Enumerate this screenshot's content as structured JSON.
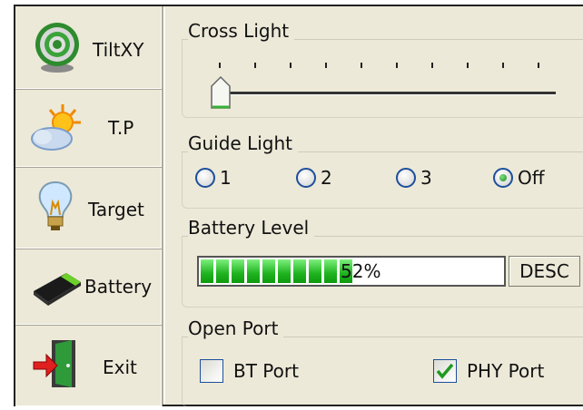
{
  "sidebar": {
    "items": [
      {
        "label": "TiltXY",
        "icon": "target-circle-icon"
      },
      {
        "label": "T.P",
        "icon": "weather-icon"
      },
      {
        "label": "Target",
        "icon": "light-bulb-icon"
      },
      {
        "label": "Battery",
        "icon": "battery-icon"
      },
      {
        "label": "Exit",
        "icon": "exit-door-icon"
      }
    ]
  },
  "cross_light": {
    "title": "Cross Light",
    "level": 0
  },
  "guide_light": {
    "title": "Guide Light",
    "options": [
      "1",
      "2",
      "3",
      "Off"
    ],
    "selected": "Off"
  },
  "battery_level": {
    "title": "Battery Level",
    "percent_label": "52%",
    "percent": 52,
    "desc_label": "DESC"
  },
  "open_port": {
    "title": "Open Port",
    "bt_port": {
      "label": "BT Port",
      "checked": false
    },
    "phy_port": {
      "label": "PHY Port",
      "checked": true
    }
  },
  "colors": {
    "background": "#ece9d8",
    "progress": "#22bb22",
    "radio_border": "#1c4f9c"
  }
}
